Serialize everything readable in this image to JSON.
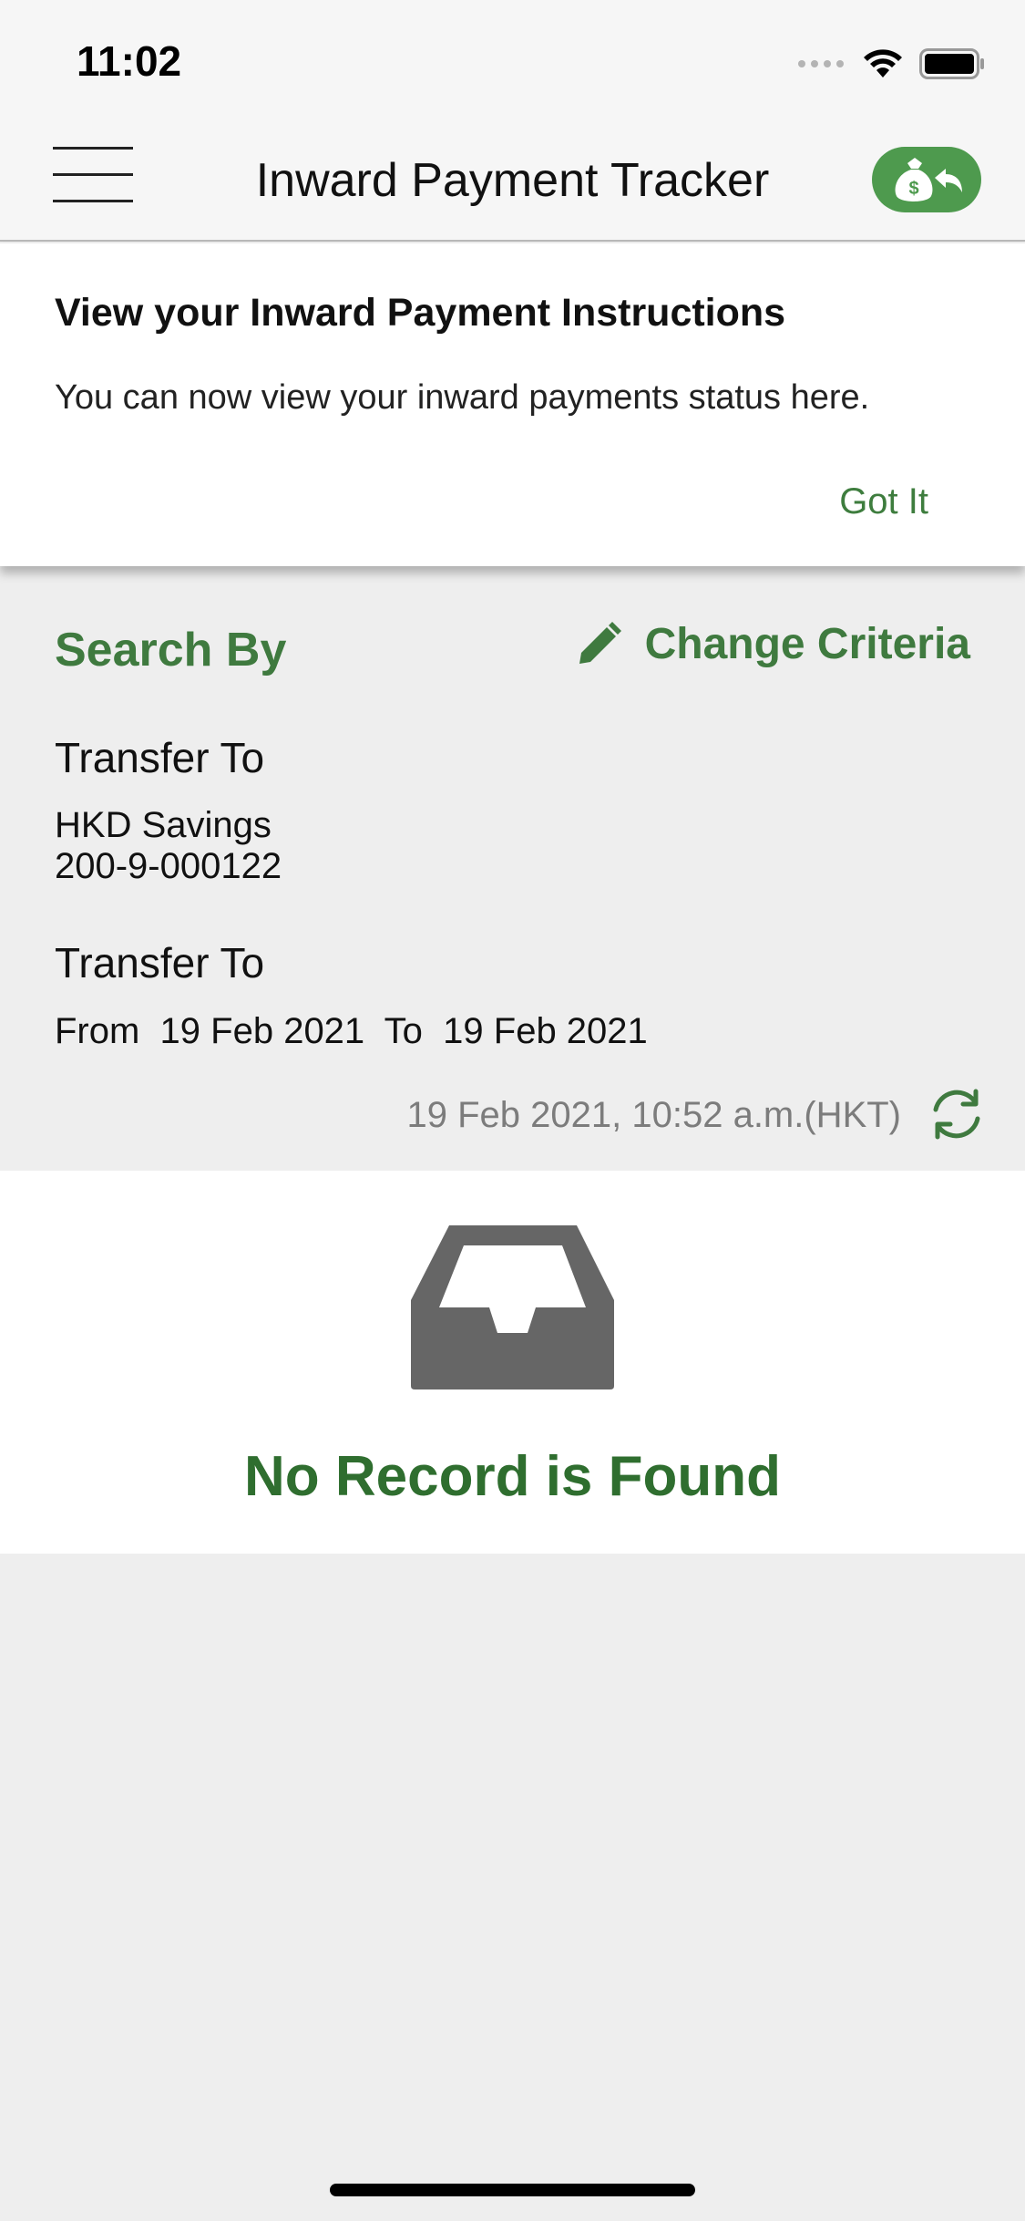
{
  "status_bar": {
    "time": "11:02"
  },
  "nav": {
    "title": "Inward Payment Tracker",
    "menu_icon": "hamburger-menu-icon",
    "action_icon": "money-bag-return-icon",
    "action_color": "#4e9a4e"
  },
  "info_panel": {
    "title": "View your Inward Payment Instructions",
    "body": "You can now view your inward payments status here.",
    "dismiss_label": "Got It"
  },
  "search": {
    "heading": "Search By",
    "change_label": "Change Criteria",
    "field1_label": "Transfer To",
    "account_name": "HKD Savings",
    "account_number": "200-9-000122",
    "field2_label": "Transfer To",
    "date_range": "From  19 Feb 2021  To  19 Feb 2021",
    "timestamp": "19 Feb 2021, 10:52 a.m.(HKT)"
  },
  "empty_state": {
    "icon": "inbox-tray-icon",
    "message": "No Record is Found"
  },
  "colors": {
    "brand_green": "#3f7a3f",
    "background": "#eeeeee"
  }
}
